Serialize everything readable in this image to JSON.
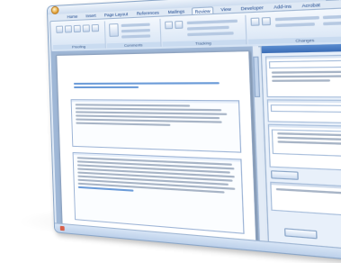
{
  "app": {
    "title": "",
    "tabs": [
      "Home",
      "Insert",
      "Page Layout",
      "References",
      "Mailings",
      "Review",
      "View",
      "Developer",
      "Add-Ins",
      "Acrobat",
      "Developer"
    ],
    "active_tab_index": 5
  },
  "ribbon": {
    "groups": [
      "Proofing",
      "Comments",
      "Tracking",
      "Changes"
    ]
  },
  "document": {
    "heading": "",
    "sections": [
      {
        "title": "",
        "lines": 6
      },
      {
        "title": "",
        "lines": 9
      }
    ]
  },
  "task_pane": {
    "title": "",
    "sections": [
      {
        "label": ""
      },
      {
        "label": ""
      },
      {
        "label": ""
      }
    ],
    "table": {
      "headers": [
        "",
        "",
        ""
      ],
      "rows": [
        [
          "",
          "",
          ""
        ]
      ]
    }
  },
  "colors": {
    "ribbon": "#d5e3f4",
    "accent": "#2f63b5",
    "workspace": "#9fb7d6"
  }
}
